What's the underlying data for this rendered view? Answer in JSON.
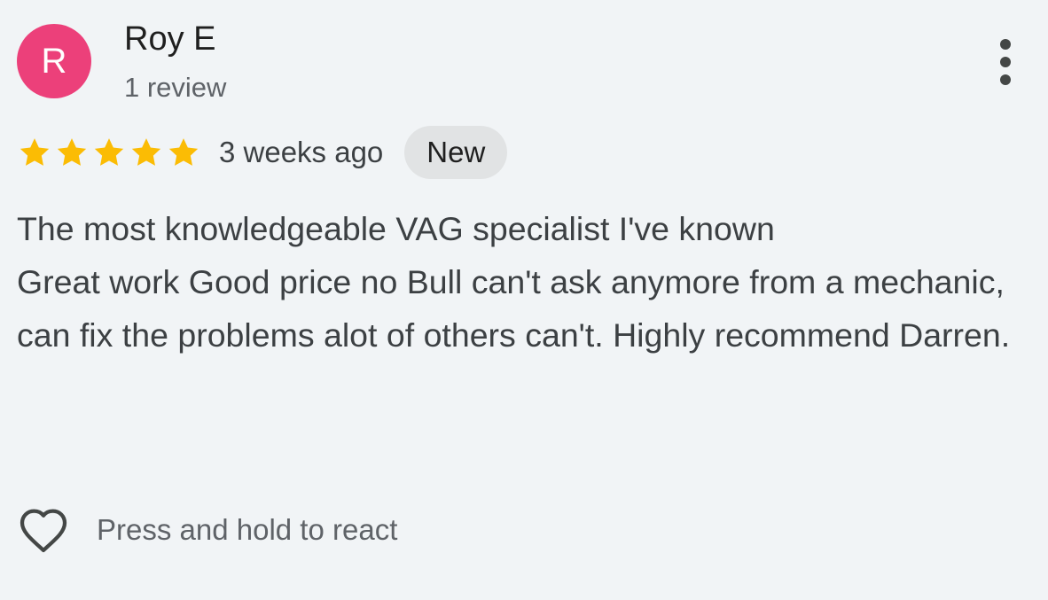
{
  "reviewer": {
    "avatar_initial": "R",
    "avatar_color": "#ec407a",
    "name": "Roy E",
    "review_count": "1 review"
  },
  "menu": {
    "icon": "more-vert-icon"
  },
  "rating": {
    "stars": 5,
    "max_stars": 5,
    "star_icon": "star-icon",
    "star_color": "#fbbc04",
    "time_ago": "3 weeks ago",
    "badge": "New"
  },
  "review": {
    "text": "The most knowledgeable VAG specialist I've known\nGreat work Good price no Bull can't ask anymore from a mechanic,\ncan fix the problems alot of others can't. Highly recommend Darren."
  },
  "reaction": {
    "icon": "heart-outline-icon",
    "label": "Press and hold to react"
  }
}
